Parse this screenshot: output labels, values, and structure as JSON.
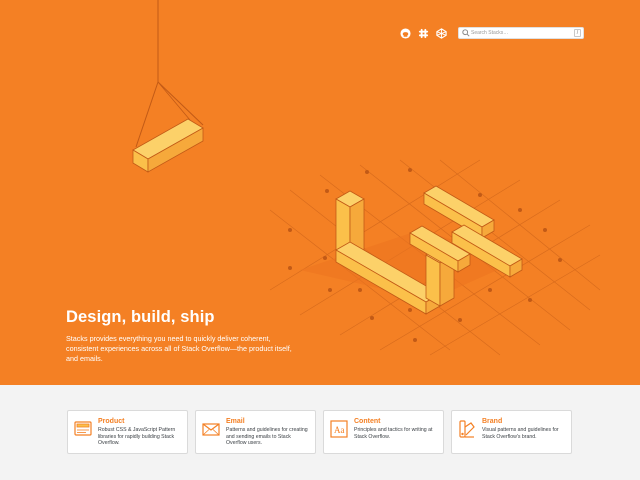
{
  "header": {
    "icons": [
      "github-icon",
      "slack-icon",
      "codepen-icon"
    ],
    "search": {
      "placeholder": "Search Stacks…",
      "shortcut": "/"
    }
  },
  "hero": {
    "title": "Design, build, ship",
    "description": "Stacks provides everything you need to quickly deliver coherent, consistent experiences across all of Stack Overflow—the product itself, and emails."
  },
  "cards": [
    {
      "icon": "product-icon",
      "title": "Product",
      "desc": "Robust CSS & JavaScript Pattern libraries for rapidly building Stack Overflow."
    },
    {
      "icon": "email-icon",
      "title": "Email",
      "desc": "Patterns and guidelines for creating and sending emails to Stack Overflow users."
    },
    {
      "icon": "content-icon",
      "title": "Content",
      "desc": "Principles and tactics for writing at Stack Overflow."
    },
    {
      "icon": "brand-icon",
      "title": "Brand",
      "desc": "Visual patterns and guidelines for Stack Overflow's brand."
    }
  ],
  "colors": {
    "brand_orange": "#f48024",
    "block_yellow": "#fbc04a",
    "text_dark": "#3b4045"
  }
}
